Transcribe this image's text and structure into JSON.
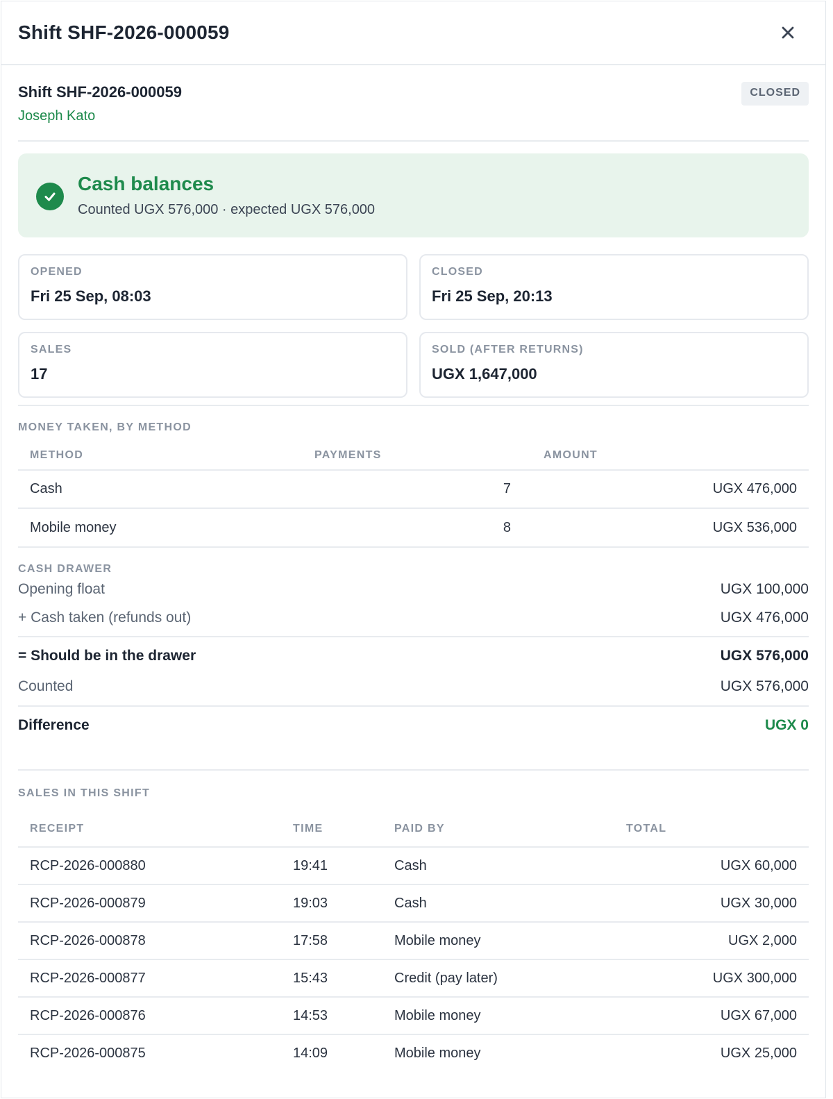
{
  "header": {
    "title": "Shift SHF-2026-000059"
  },
  "shift": {
    "name": "Shift SHF-2026-000059",
    "person": "Joseph Kato",
    "status": "CLOSED"
  },
  "balance": {
    "title": "Cash balances",
    "subtitle": "Counted UGX 576,000 · expected UGX 576,000"
  },
  "stats": [
    {
      "label": "OPENED",
      "value": "Fri 25 Sep, 08:03"
    },
    {
      "label": "CLOSED",
      "value": "Fri 25 Sep, 20:13"
    },
    {
      "label": "SALES",
      "value": "17"
    },
    {
      "label": "SOLD (AFTER RETURNS)",
      "value": "UGX 1,647,000"
    }
  ],
  "methods": {
    "section_label": "MONEY TAKEN, BY METHOD",
    "columns": [
      "METHOD",
      "PAYMENTS",
      "AMOUNT"
    ],
    "rows": [
      {
        "method": "Cash",
        "payments": "7",
        "amount": "UGX 476,000"
      },
      {
        "method": "Mobile money",
        "payments": "8",
        "amount": "UGX 536,000"
      }
    ]
  },
  "drawer": {
    "section_label": "CASH DRAWER",
    "opening_label": "Opening float",
    "opening_value": "UGX 100,000",
    "taken_label": "+ Cash taken (refunds out)",
    "taken_value": "UGX 476,000",
    "should_label": "= Should be in the drawer",
    "should_value": "UGX 576,000",
    "counted_label": "Counted",
    "counted_value": "UGX 576,000",
    "difference_label": "Difference",
    "difference_value": "UGX 0"
  },
  "sales": {
    "section_label": "SALES IN THIS SHIFT",
    "columns": [
      "RECEIPT",
      "TIME",
      "PAID BY",
      "TOTAL"
    ],
    "rows": [
      {
        "receipt": "RCP-2026-000880",
        "time": "19:41",
        "paid_by": "Cash",
        "total": "UGX 60,000"
      },
      {
        "receipt": "RCP-2026-000879",
        "time": "19:03",
        "paid_by": "Cash",
        "total": "UGX 30,000"
      },
      {
        "receipt": "RCP-2026-000878",
        "time": "17:58",
        "paid_by": "Mobile money",
        "total": "UGX 2,000"
      },
      {
        "receipt": "RCP-2026-000877",
        "time": "15:43",
        "paid_by": "Credit (pay later)",
        "total": "UGX 300,000"
      },
      {
        "receipt": "RCP-2026-000876",
        "time": "14:53",
        "paid_by": "Mobile money",
        "total": "UGX 67,000"
      },
      {
        "receipt": "RCP-2026-000875",
        "time": "14:09",
        "paid_by": "Mobile money",
        "total": "UGX 25,000"
      }
    ]
  },
  "colors": {
    "accent_green": "#1e8a4c",
    "success_bg": "#e8f4ec",
    "badge_bg": "#eef1f4"
  },
  "icons": {
    "close": "close-icon",
    "check": "check-circle-icon"
  }
}
